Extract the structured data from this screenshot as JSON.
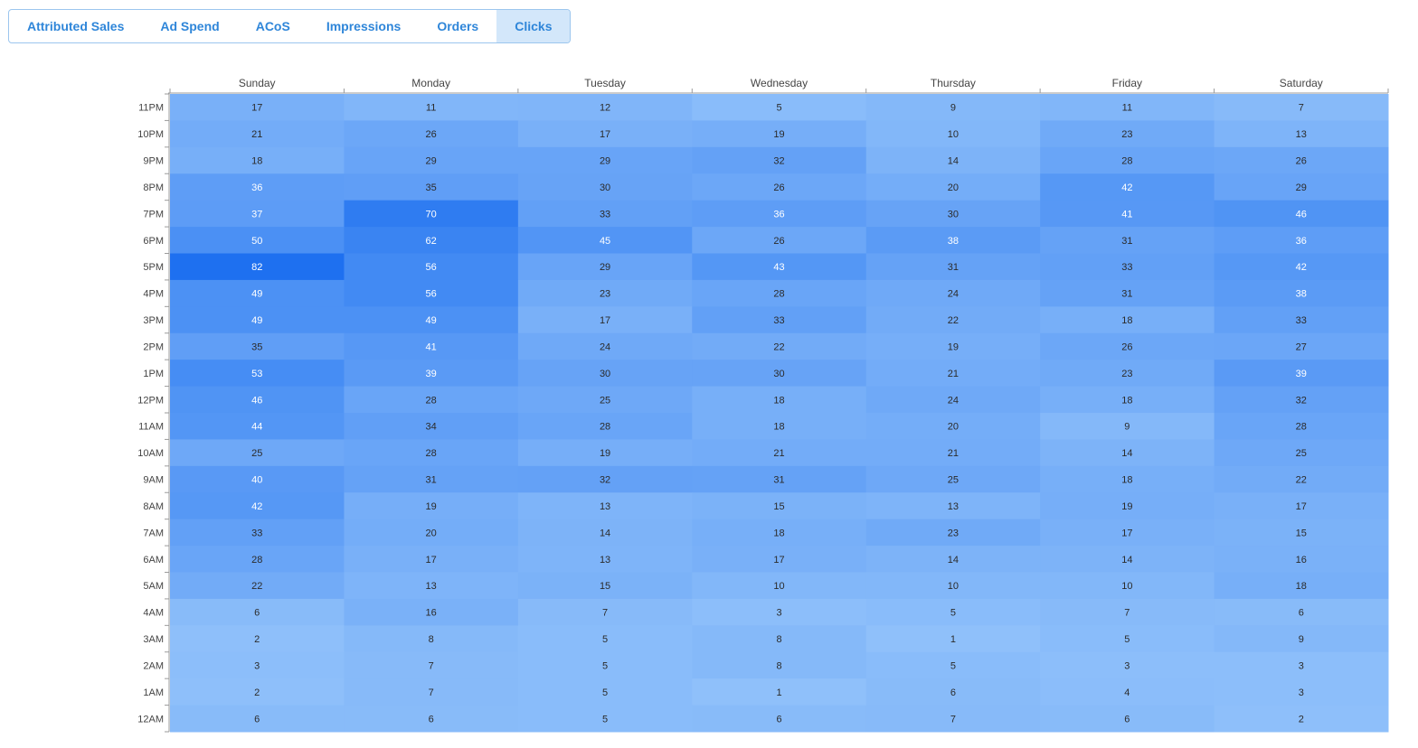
{
  "tabs": [
    {
      "label": "Attributed Sales",
      "active": false
    },
    {
      "label": "Ad Spend",
      "active": false
    },
    {
      "label": "ACoS",
      "active": false
    },
    {
      "label": "Impressions",
      "active": false
    },
    {
      "label": "Orders",
      "active": false
    },
    {
      "label": "Clicks",
      "active": true
    }
  ],
  "colors": {
    "tab_text": "#2f86d9",
    "tab_active_bg": "#d3e7fa",
    "tab_border": "#9cc6ee",
    "cell_low": "#8fc0fa",
    "cell_high": "#1e70f0"
  },
  "chart_data": {
    "type": "heatmap",
    "x": [
      "Sunday",
      "Monday",
      "Tuesday",
      "Wednesday",
      "Thursday",
      "Friday",
      "Saturday"
    ],
    "y": [
      "11PM",
      "10PM",
      "9PM",
      "8PM",
      "7PM",
      "6PM",
      "5PM",
      "4PM",
      "3PM",
      "2PM",
      "1PM",
      "12PM",
      "11AM",
      "10AM",
      "9AM",
      "8AM",
      "7AM",
      "6AM",
      "5AM",
      "4AM",
      "3AM",
      "2AM",
      "1AM",
      "12AM"
    ],
    "values": [
      [
        17,
        11,
        12,
        5,
        9,
        11,
        7
      ],
      [
        21,
        26,
        17,
        19,
        10,
        23,
        13
      ],
      [
        18,
        29,
        29,
        32,
        14,
        28,
        26
      ],
      [
        36,
        35,
        30,
        26,
        20,
        42,
        29
      ],
      [
        37,
        70,
        33,
        36,
        30,
        41,
        46
      ],
      [
        50,
        62,
        45,
        26,
        38,
        31,
        36
      ],
      [
        82,
        56,
        29,
        43,
        31,
        33,
        42
      ],
      [
        49,
        56,
        23,
        28,
        24,
        31,
        38
      ],
      [
        49,
        49,
        17,
        33,
        22,
        18,
        33
      ],
      [
        35,
        41,
        24,
        22,
        19,
        26,
        27
      ],
      [
        53,
        39,
        30,
        30,
        21,
        23,
        39
      ],
      [
        46,
        28,
        25,
        18,
        24,
        18,
        32
      ],
      [
        44,
        34,
        28,
        18,
        20,
        9,
        28
      ],
      [
        25,
        28,
        19,
        21,
        21,
        14,
        25
      ],
      [
        40,
        31,
        32,
        31,
        25,
        18,
        22
      ],
      [
        42,
        19,
        13,
        15,
        13,
        19,
        17
      ],
      [
        33,
        20,
        14,
        18,
        23,
        17,
        15
      ],
      [
        28,
        17,
        13,
        17,
        14,
        14,
        16
      ],
      [
        22,
        13,
        15,
        10,
        10,
        10,
        18
      ],
      [
        6,
        16,
        7,
        3,
        5,
        7,
        6
      ],
      [
        2,
        8,
        5,
        8,
        1,
        5,
        9
      ],
      [
        3,
        7,
        5,
        8,
        5,
        3,
        3
      ],
      [
        2,
        7,
        5,
        1,
        6,
        4,
        3
      ],
      [
        6,
        6,
        5,
        6,
        7,
        6,
        2
      ]
    ],
    "value_range": [
      1,
      82
    ]
  }
}
